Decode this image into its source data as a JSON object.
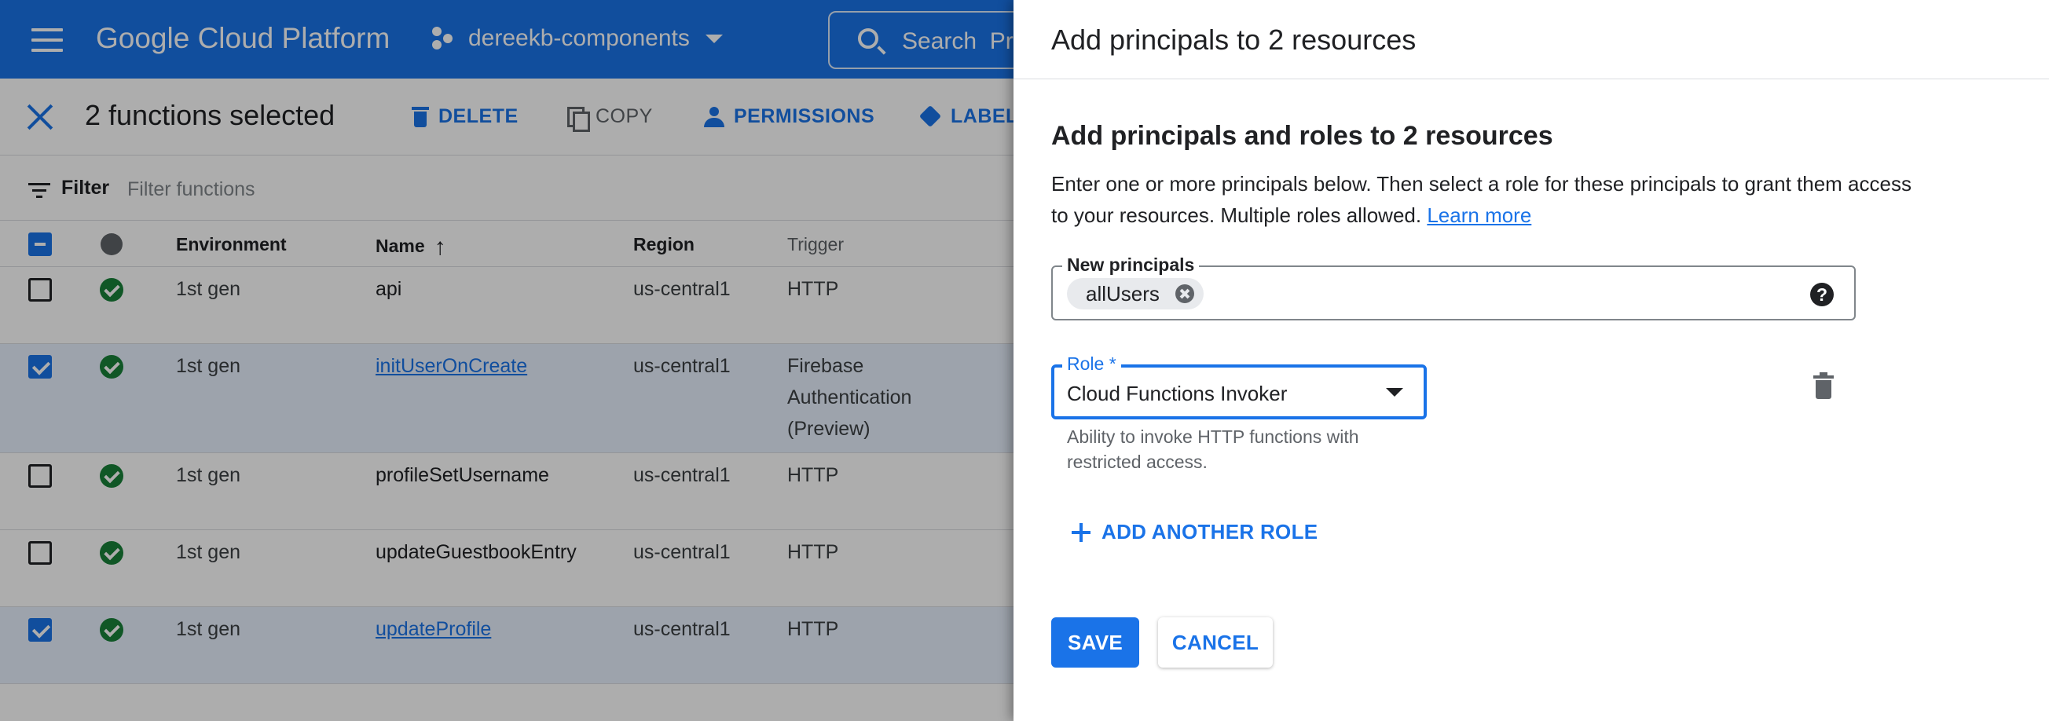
{
  "topbar": {
    "brand": "Google Cloud Platform",
    "project": "dereekb-components",
    "search_placeholder": "Search",
    "search_overflow": "Pr"
  },
  "actionbar": {
    "selection_title": "2 functions selected",
    "actions": {
      "delete": "DELETE",
      "copy": "COPY",
      "permissions": "PERMISSIONS",
      "labels": "LABELS"
    }
  },
  "filter": {
    "label": "Filter",
    "placeholder": "Filter functions"
  },
  "table": {
    "columns": {
      "environment": "Environment",
      "name": "Name",
      "region": "Region",
      "trigger": "Trigger"
    },
    "sort_arrow": "↑",
    "rows": [
      {
        "environment": "1st gen",
        "name": "api",
        "region": "us-central1",
        "trigger": "HTTP",
        "selected": false
      },
      {
        "environment": "1st gen",
        "name": "initUserOnCreate",
        "region": "us-central1",
        "trigger": "Firebase Authentication (Preview)",
        "selected": true
      },
      {
        "environment": "1st gen",
        "name": "profileSetUsername",
        "region": "us-central1",
        "trigger": "HTTP",
        "selected": false
      },
      {
        "environment": "1st gen",
        "name": "updateGuestbookEntry",
        "region": "us-central1",
        "trigger": "HTTP",
        "selected": false
      },
      {
        "environment": "1st gen",
        "name": "updateProfile",
        "region": "us-central1",
        "trigger": "HTTP",
        "selected": true
      }
    ]
  },
  "panel": {
    "title": "Add principals to 2 resources",
    "section_title": "Add principals and roles to 2 resources",
    "description": "Enter one or more principals below. Then select a role for these principals to grant them access to your resources. Multiple roles allowed.",
    "learn_more": "Learn more",
    "principals_label": "New principals",
    "principal_chip": "allUsers",
    "help_glyph": "?",
    "role_label": "Role *",
    "role_value": "Cloud Functions Invoker",
    "role_help": "Ability to invoke HTTP functions with restricted access.",
    "add_role": "ADD ANOTHER ROLE",
    "save": "SAVE",
    "cancel": "CANCEL"
  },
  "colors": {
    "brand_blue": "#1a73e8",
    "success_green": "#188038",
    "scrim": "rgba(0,0,0,0.32)"
  }
}
